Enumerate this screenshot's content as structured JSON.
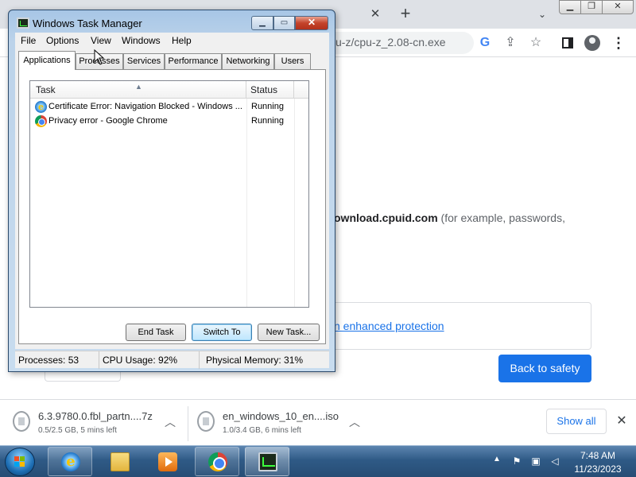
{
  "browser": {
    "url": "u-z/cpu-z_2.08-cn.exe",
    "page_text_bold": "ownload.cpuid.com",
    "page_text_rest": " (for example, passwords,",
    "enhanced_link": "n enhanced protection",
    "back_button": "Back to safety",
    "tab_close": "✕",
    "new_tab": "+",
    "tab_search": "⌄",
    "google_icon": "G"
  },
  "downloads": {
    "items": [
      {
        "name": "6.3.9780.0.fbl_partn....7z",
        "status": "0.5/2.5 GB, 5 mins left"
      },
      {
        "name": "en_windows_10_en....iso",
        "status": "1.0/3.4 GB, 6 mins left"
      }
    ],
    "show_all": "Show all"
  },
  "task_manager": {
    "title": "Windows Task Manager",
    "menu": [
      "File",
      "Options",
      "View",
      "Windows",
      "Help"
    ],
    "tabs": [
      "Applications",
      "Processes",
      "Services",
      "Performance",
      "Networking",
      "Users"
    ],
    "active_tab": "Applications",
    "columns": {
      "task": "Task",
      "status": "Status"
    },
    "rows": [
      {
        "task": "Certificate Error: Navigation Blocked - Windows ...",
        "status": "Running",
        "icon": "ie-icon"
      },
      {
        "task": "Privacy error - Google Chrome",
        "status": "Running",
        "icon": "chrome-icon"
      }
    ],
    "buttons": {
      "end_task": "End Task",
      "switch_to": "Switch To",
      "new_task": "New Task..."
    },
    "statusbar": {
      "processes": "Processes: 53",
      "cpu": "CPU Usage: 92%",
      "memory": "Physical Memory: 31%"
    }
  },
  "taskbar": {
    "time": "7:48 AM",
    "date": "11/23/2023",
    "apps": [
      "internet-explorer",
      "windows-explorer",
      "media-player",
      "google-chrome",
      "task-manager"
    ]
  }
}
